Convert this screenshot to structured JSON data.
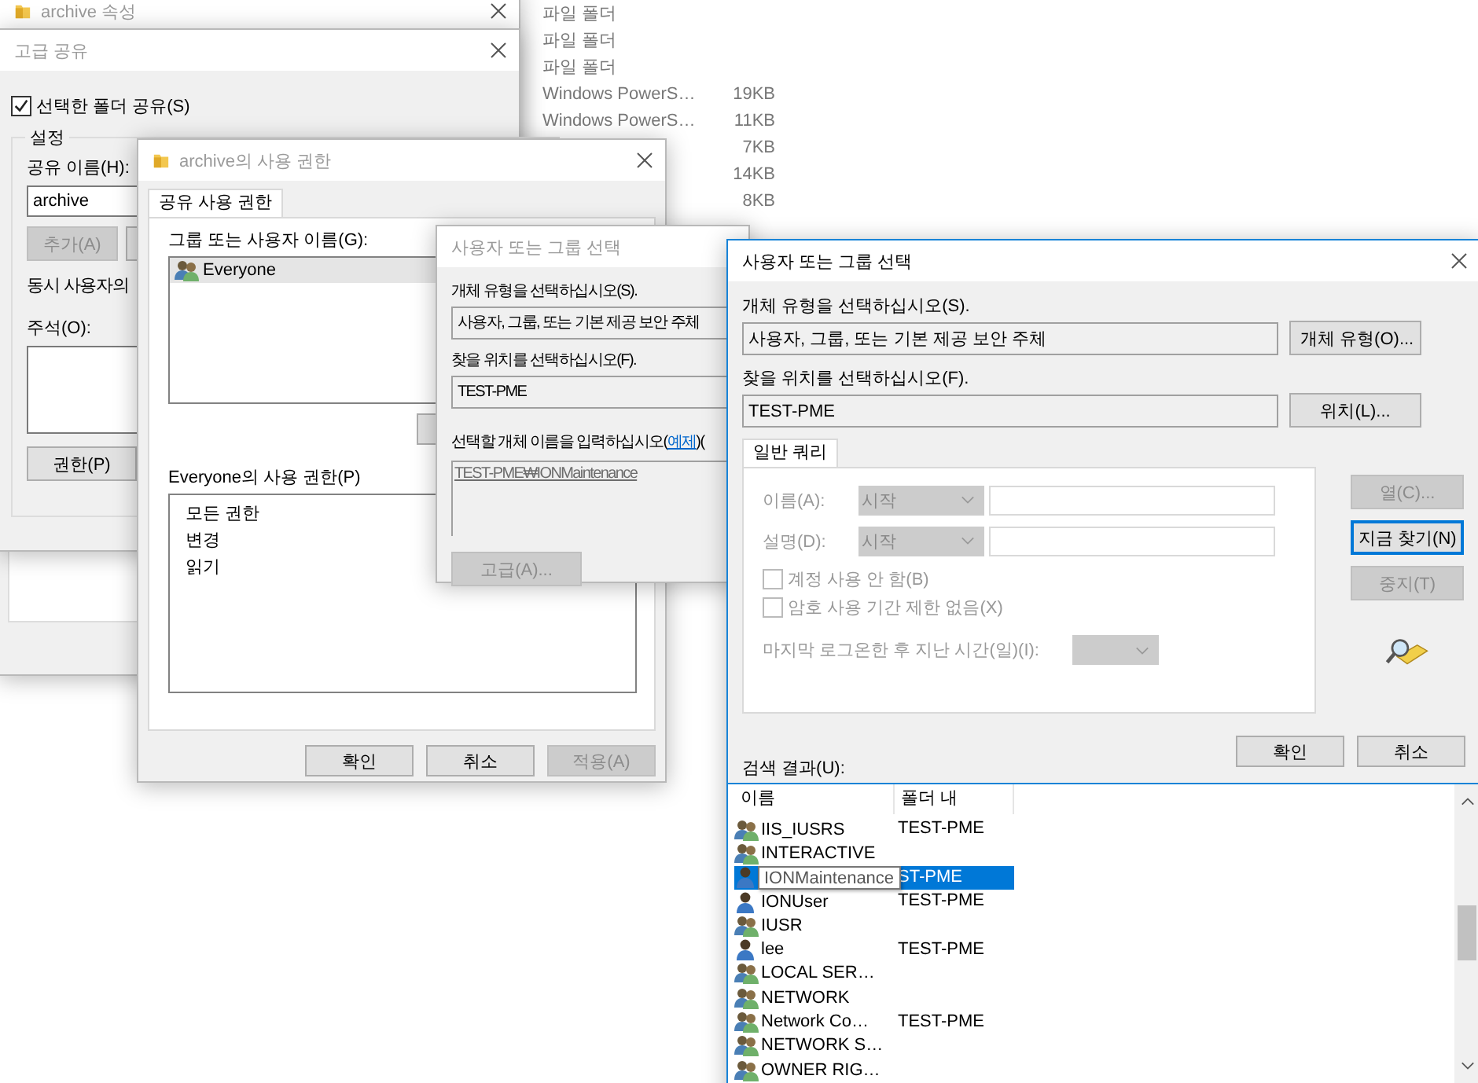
{
  "file_list": {
    "rows": [
      {
        "type": "파일 폴더"
      },
      {
        "type": "파일 폴더"
      },
      {
        "type": "파일 폴더"
      },
      {
        "type": "Windows PowerS…",
        "size": "19KB"
      },
      {
        "type": "Windows PowerS…",
        "size": "11KB"
      },
      {
        "size": "7KB"
      },
      {
        "size": "14KB"
      },
      {
        "size": "8KB"
      }
    ]
  },
  "archive_properties": {
    "title": "archive 속성",
    "active": false
  },
  "advanced_sharing": {
    "title": "고급 공유",
    "active": false,
    "share_checkbox": {
      "label": "선택한 폴더 공유(S)",
      "checked": true
    },
    "group_label": "설정",
    "share_name_label": "공유 이름(H):",
    "share_name": "archive",
    "add_button": {
      "label": "추가(A)",
      "disabled": true
    },
    "user_limit_label": "동시 사용자의",
    "comment_label": "주석(O):",
    "permissions_button": "권한(P)"
  },
  "permissions_window": {
    "title": "archive의 사용 권한",
    "active": false,
    "tab": {
      "label": "공유 사용 권한",
      "selected": true
    },
    "names_label": "그룹 또는 사용자 이름(G):",
    "names": [
      {
        "name": "Everyone",
        "kind": "group"
      }
    ],
    "permissions_label": "Everyone의 사용 권한(P)",
    "permissions": [
      "모든 권한",
      "변경",
      "읽기"
    ],
    "buttons": [
      {
        "label": "확인",
        "disabled": false
      },
      {
        "label": "취소",
        "disabled": false
      },
      {
        "label": "적용(A)",
        "disabled": true
      }
    ]
  },
  "select_dialog_back": {
    "title": "사용자 또는 그룹 선택",
    "active": false,
    "object_type_label": "개체 유형을 선택하십시오(S).",
    "object_type": "사용자, 그룹, 또는 기본 제공 보안 주체",
    "location_label": "찾을 위치를 선택하십시오(F).",
    "location": "TEST-PME",
    "names_label": "선택할 개체 이름을 입력하십시오(",
    "names_link": "예제",
    "names_suffix": ")(",
    "names_value": "TEST-PME₩IONMaintenance",
    "advanced_button": {
      "label": "고급(A)...",
      "disabled": true
    }
  },
  "select_dialog": {
    "title": "사용자 또는 그룹 선택",
    "active": true,
    "object_type_label": "개체 유형을 선택하십시오(S).",
    "object_type": "사용자, 그룹, 또는 기본 제공 보안 주체",
    "object_type_button": "개체 유형(O)...",
    "location_label": "찾을 위치를 선택하십시오(F).",
    "location": "TEST-PME",
    "location_button": "위치(L)...",
    "tab": {
      "label": "일반 쿼리",
      "selected": true
    },
    "query_rows": [
      {
        "label": "이름(A):",
        "condition": "시작"
      },
      {
        "label": "설명(D):",
        "condition": "시작"
      }
    ],
    "checkboxes": [
      {
        "label": "계정 사용 안 함(B)",
        "checked": false
      },
      {
        "label": "암호 사용 기간 제한 없음(X)",
        "checked": false
      }
    ],
    "last_logon_label": "마지막 로그온한 후 지난 시간(일)(I):",
    "side_buttons": [
      {
        "label": "열(C)...",
        "disabled": true,
        "focused": false
      },
      {
        "label": "지금 찾기(N)",
        "disabled": false,
        "focused": true
      },
      {
        "label": "중지(T)",
        "disabled": true,
        "focused": false
      }
    ],
    "buttons": [
      {
        "label": "확인",
        "disabled": false
      },
      {
        "label": "취소",
        "disabled": false
      }
    ],
    "results_label": "검색 결과(U):",
    "columns": [
      "이름",
      "폴더 내"
    ],
    "rows": [
      {
        "name": "IIS_IUSRS",
        "folder": "TEST-PME",
        "kind": "group",
        "selected": false
      },
      {
        "name": "INTERACTIVE",
        "kind": "group",
        "selected": false
      },
      {
        "tooltip": "IONMaintenance",
        "folder": "ST-PME",
        "kind": "user",
        "selected": true
      },
      {
        "name": "IONUser",
        "folder": "TEST-PME",
        "kind": "user",
        "selected": false
      },
      {
        "name": "IUSR",
        "kind": "group",
        "selected": false
      },
      {
        "name": "lee",
        "folder": "TEST-PME",
        "kind": "user",
        "selected": false
      },
      {
        "name": "LOCAL SER…",
        "kind": "group",
        "selected": false
      },
      {
        "name": "NETWORK",
        "kind": "group",
        "selected": false
      },
      {
        "name": "Network Co…",
        "folder": "TEST-PME",
        "kind": "group",
        "selected": false
      },
      {
        "name": "NETWORK S…",
        "kind": "group",
        "selected": false
      },
      {
        "name": "OWNER RIG…",
        "kind": "group",
        "selected": false
      }
    ]
  }
}
